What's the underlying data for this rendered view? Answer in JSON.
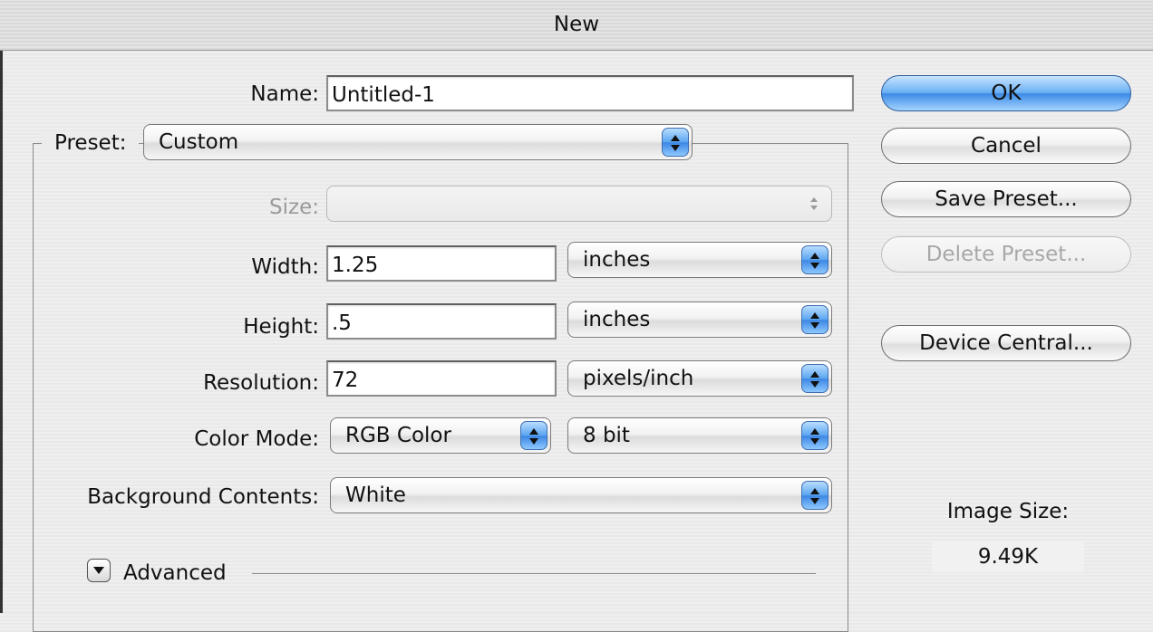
{
  "window": {
    "title": "New"
  },
  "name": {
    "label": "Name:",
    "value": "Untitled-1"
  },
  "preset": {
    "label": "Preset:",
    "value": "Custom"
  },
  "size": {
    "label": "Size:",
    "value": ""
  },
  "width": {
    "label": "Width:",
    "value": "1.25",
    "unit": "inches"
  },
  "height": {
    "label": "Height:",
    "value": ".5",
    "unit": "inches"
  },
  "resolution": {
    "label": "Resolution:",
    "value": "72",
    "unit": "pixels/inch"
  },
  "color_mode": {
    "label": "Color Mode:",
    "value": "RGB Color",
    "depth": "8 bit"
  },
  "background": {
    "label": "Background Contents:",
    "value": "White"
  },
  "advanced": {
    "label": "Advanced"
  },
  "buttons": {
    "ok": "OK",
    "cancel": "Cancel",
    "save_preset": "Save Preset...",
    "delete_preset": "Delete Preset...",
    "device_central": "Device Central..."
  },
  "image_size": {
    "label": "Image Size:",
    "value": "9.49K"
  },
  "icons": {
    "popup_arrows": "up-down-arrows-icon",
    "disclosure": "disclosure-triangle-icon"
  },
  "colors": {
    "accent": "#4a93ea"
  }
}
